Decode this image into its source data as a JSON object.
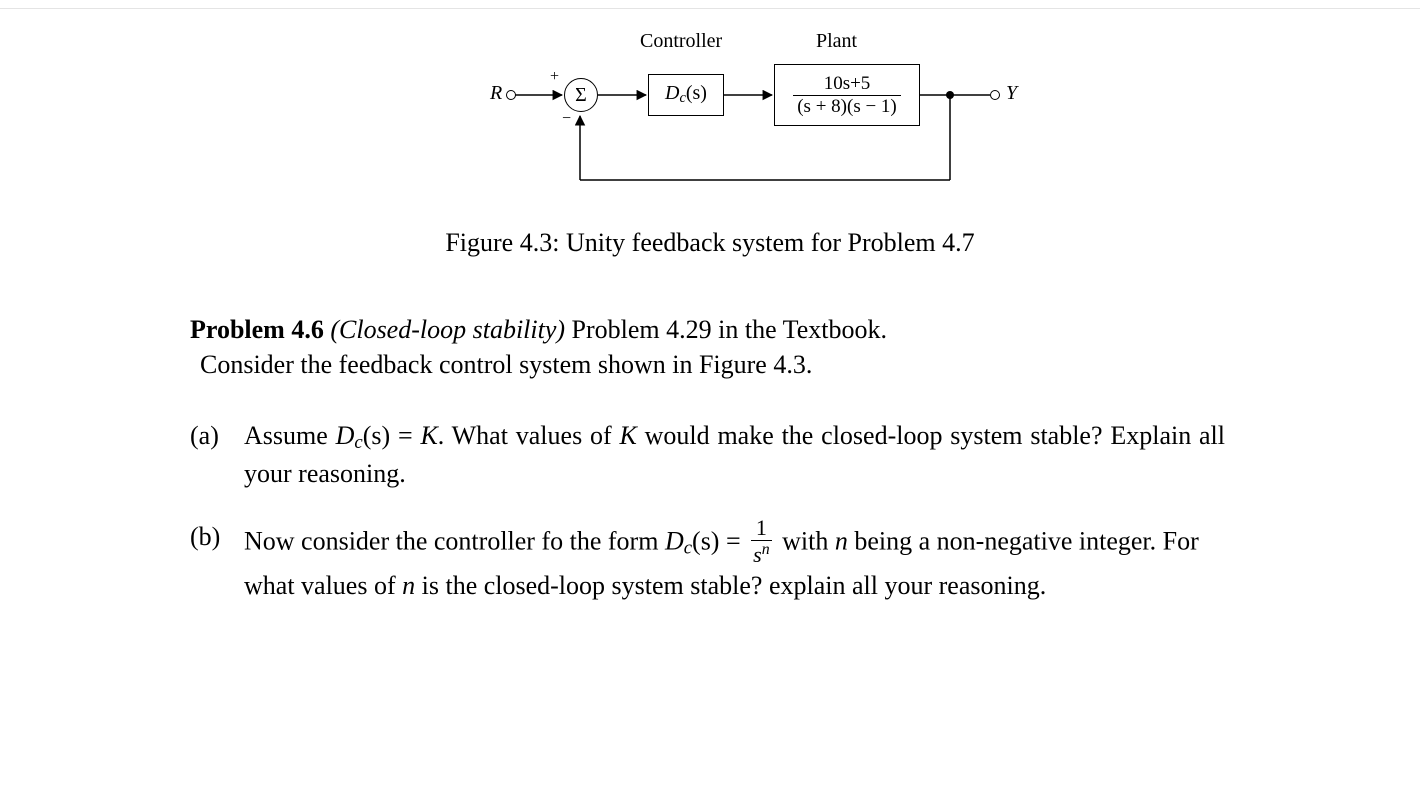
{
  "diagram": {
    "controller_label": "Controller",
    "plant_label": "Plant",
    "input_label": "R",
    "output_label": "Y",
    "sum_symbol": "Σ",
    "sum_plus": "+",
    "sum_minus": "−",
    "controller_tf": "D",
    "controller_tf_sub": "c",
    "controller_tf_arg": "(s)",
    "plant_num": "10s+5",
    "plant_den_left": "(s + 8)(s − 1)"
  },
  "caption": "Figure 4.3: Unity feedback system for Problem 4.7",
  "problem": {
    "number": "Problem 4.6",
    "title": "(Closed-loop stability)",
    "rest": " Problem 4.29 in the Textbook.",
    "line2": "Consider the feedback control system shown in Figure 4.3."
  },
  "parts": {
    "a": {
      "label": "(a)",
      "text_pre": "Assume ",
      "dc": "D",
      "dc_sub": "c",
      "dc_arg": "(s)",
      "eq": " = ",
      "k": "K",
      "text_mid": ". What values of ",
      "k2": "K",
      "text_post": " would make the closed-loop system stable? Explain all your reasoning."
    },
    "b": {
      "label": "(b)",
      "text_pre": "Now consider the controller fo the form ",
      "dc": "D",
      "dc_sub": "c",
      "dc_arg": "(s)",
      "eq": " = ",
      "frac_num": "1",
      "frac_den_base": "s",
      "frac_den_exp": "n",
      "text_mid": " with ",
      "nvar": "n",
      "text_mid2": " being a non-negative integer. For what values of ",
      "nvar2": "n",
      "text_post": " is the closed-loop system stable? explain all your reasoning."
    }
  }
}
